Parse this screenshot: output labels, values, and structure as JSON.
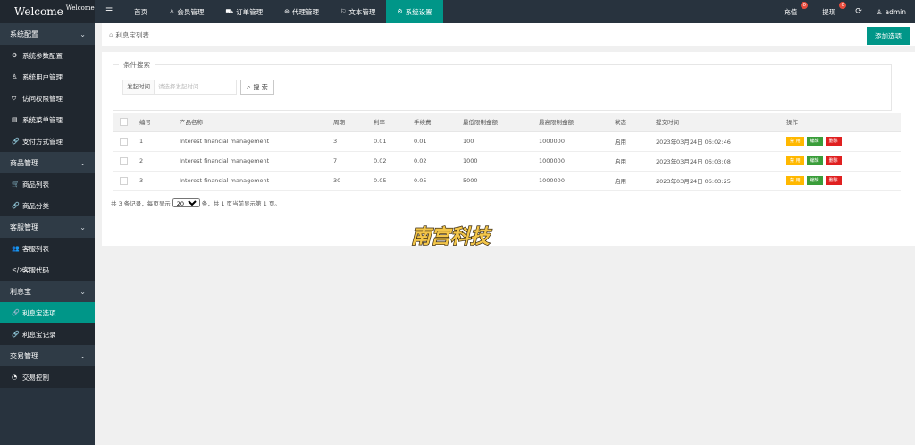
{
  "brand": {
    "title": "Welcome",
    "sup": "Welcome"
  },
  "sidebar": {
    "groups": [
      {
        "label": "系统配置",
        "items": [
          {
            "icon": "gear-icon",
            "label": "系统参数配置"
          },
          {
            "icon": "user-icon",
            "label": "系统用户管理"
          },
          {
            "icon": "shield-icon",
            "label": "访问权限管理"
          },
          {
            "icon": "menu-icon",
            "label": "系统菜单管理"
          },
          {
            "icon": "link-icon",
            "label": "支付方式管理"
          }
        ]
      },
      {
        "label": "商品管理",
        "items": [
          {
            "icon": "cart-icon",
            "label": "商品列表"
          },
          {
            "icon": "link-icon",
            "label": "商品分类"
          }
        ]
      },
      {
        "label": "客服管理",
        "items": [
          {
            "icon": "users-icon",
            "label": "客服列表"
          },
          {
            "icon": "code-icon",
            "label": "客服代码"
          }
        ]
      },
      {
        "label": "利息宝",
        "items": [
          {
            "icon": "link-icon",
            "label": "利息宝选项",
            "active": true
          },
          {
            "icon": "link-icon",
            "label": "利息宝记录"
          }
        ]
      },
      {
        "label": "交易管理",
        "items": [
          {
            "icon": "dashboard-icon",
            "label": "交易控制"
          }
        ]
      }
    ]
  },
  "topbar": {
    "menu": [
      {
        "icon": "",
        "label": "首页"
      },
      {
        "icon": "user-icon",
        "label": "会员管理"
      },
      {
        "icon": "car-icon",
        "label": "订单管理"
      },
      {
        "icon": "money-icon",
        "label": "代理管理"
      },
      {
        "icon": "flag-icon",
        "label": "文本管理"
      },
      {
        "icon": "gear-icon",
        "label": "系统设置",
        "active": true
      }
    ],
    "right": {
      "recharge": "充值",
      "recharge_badge": "0",
      "withdraw": "提现",
      "withdraw_badge": "0",
      "user": "admin"
    }
  },
  "breadcrumb": "利息宝列表",
  "add_button": "添加选项",
  "search": {
    "legend": "条件搜索",
    "label": "发起时间",
    "placeholder": "请选择发起时间",
    "button": "搜 索"
  },
  "table": {
    "headers": [
      "编号",
      "产品名称",
      "周期",
      "利率",
      "手续费",
      "最低限制金额",
      "最高限制金额",
      "状态",
      "提交时间",
      "操作"
    ],
    "rows": [
      [
        "1",
        "Interest financial management",
        "3",
        "0.01",
        "0.01",
        "100",
        "1000000",
        "启用",
        "2023年03月24日 06:02:46"
      ],
      [
        "2",
        "Interest financial management",
        "7",
        "0.02",
        "0.02",
        "1000",
        "1000000",
        "启用",
        "2023年03月24日 06:03:08"
      ],
      [
        "3",
        "Interest financial management",
        "30",
        "0.05",
        "0.05",
        "5000",
        "1000000",
        "启用",
        "2023年03月24日 06:03:25"
      ]
    ],
    "actions": [
      "禁 用",
      "编辑",
      "删除"
    ]
  },
  "pager": {
    "prefix": "共 3 条记录，每页显示",
    "page_size": "20",
    "suffix": "条，共 1 页当前显示第 1 页。"
  },
  "watermark": "南宫科技",
  "colors": {
    "sidebar": "#28333e",
    "accent": "#009688"
  }
}
